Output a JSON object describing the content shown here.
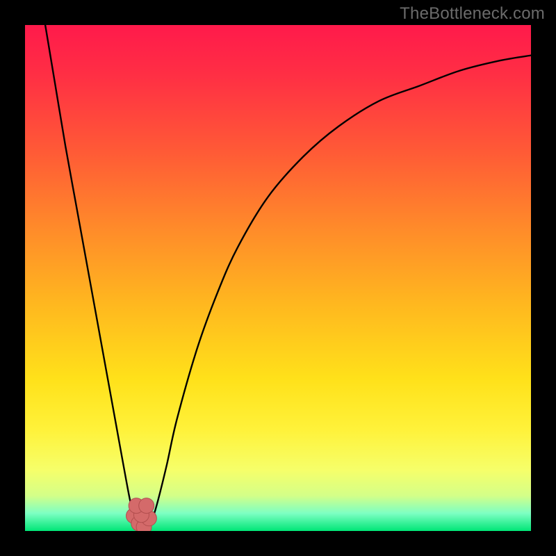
{
  "watermark": "TheBottleneck.com",
  "colors": {
    "frame": "#000000",
    "curve": "#000000",
    "marker_fill": "#d46a6a",
    "marker_stroke": "#b24e4e",
    "gradient_stops": [
      {
        "offset": 0.0,
        "color": "#ff1a4b"
      },
      {
        "offset": 0.1,
        "color": "#ff2f44"
      },
      {
        "offset": 0.25,
        "color": "#ff5a36"
      },
      {
        "offset": 0.4,
        "color": "#ff8a2a"
      },
      {
        "offset": 0.55,
        "color": "#ffb71f"
      },
      {
        "offset": 0.7,
        "color": "#ffe11a"
      },
      {
        "offset": 0.8,
        "color": "#fff23a"
      },
      {
        "offset": 0.88,
        "color": "#f6ff6a"
      },
      {
        "offset": 0.93,
        "color": "#d4ff88"
      },
      {
        "offset": 0.965,
        "color": "#7dffc3"
      },
      {
        "offset": 1.0,
        "color": "#00e676"
      }
    ]
  },
  "chart_data": {
    "type": "line",
    "title": "",
    "xlabel": "",
    "ylabel": "",
    "xlim": [
      0,
      100
    ],
    "ylim": [
      0,
      100
    ],
    "grid": false,
    "series": [
      {
        "name": "bottleneck-curve",
        "x": [
          4,
          6,
          8,
          10,
          12,
          14,
          16,
          18,
          20,
          21,
          22,
          23,
          24,
          25,
          26,
          28,
          30,
          34,
          38,
          42,
          48,
          55,
          62,
          70,
          78,
          86,
          94,
          100
        ],
        "y": [
          100,
          88,
          76,
          65,
          54,
          43,
          32,
          21,
          10,
          5,
          2,
          0.5,
          0.5,
          2,
          5,
          13,
          22,
          36,
          47,
          56,
          66,
          74,
          80,
          85,
          88,
          91,
          93,
          94
        ]
      }
    ],
    "markers": {
      "name": "minimum-cluster",
      "x": [
        21.5,
        22.5,
        23.5,
        24.5,
        23.0,
        22.0,
        24.0
      ],
      "y": [
        3.0,
        1.5,
        0.8,
        2.5,
        3.2,
        5.0,
        5.0
      ]
    }
  }
}
